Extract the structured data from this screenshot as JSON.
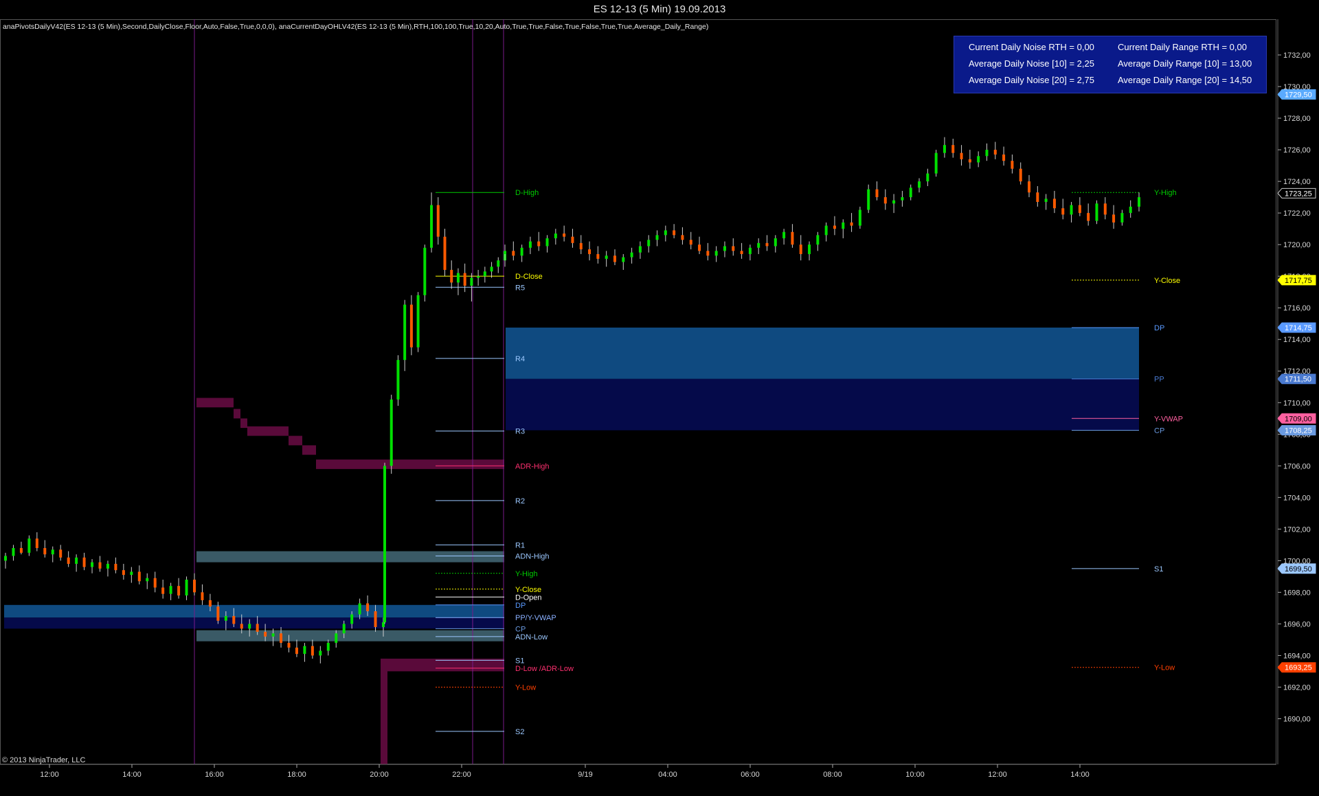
{
  "window": {
    "title": "ES 12-13 (5 Min)  19.09.2013"
  },
  "indicators_text": "anaPivotsDailyV42(ES 12-13 (5 Min),Second,DailyClose,Floor,Auto,False,True,0,0,0), anaCurrentDayOHLV42(ES 12-13 (5 Min),RTH,100,100,True,10,20,Auto,True,True,False,True,False,True,True,Average_Daily_Range)",
  "copyright": "© 2013 NinjaTrader, LLC",
  "infobox": {
    "current_noise": "Current Daily Noise RTH = 0,00",
    "current_range": "Current Daily Range RTH = 0,00",
    "avg_noise_10": "Average Daily Noise [10] = 2,25",
    "avg_range_10": "Average Daily Range [10] = 13,00",
    "avg_noise_20": "Average Daily Noise [20] = 2,75",
    "avg_range_20": "Average Daily Range [20] = 14,50"
  },
  "colors": {
    "background": "#000000",
    "up_candle": "#00e000",
    "down_candle": "#ff5a00",
    "pivot_line": "#9cc8ff",
    "high_line": "#00cc00",
    "close_line": "#ffff00",
    "low_line": "#ff4000",
    "adr_band": "#5a0a3a",
    "pivot_zone_upper": "#0f4a80",
    "pivot_zone_lower": "#050a4a",
    "adn_band": "#3a5a66",
    "session_divider": "#7a1a8a"
  },
  "chart_data": {
    "type": "candlestick",
    "title": "ES 12-13 (5 Min)  19.09.2013",
    "ylim": [
      1688.5,
      1733.0
    ],
    "y_ticks": [
      "1690,00",
      "1692,00",
      "1694,00",
      "1696,00",
      "1698,00",
      "1700,00",
      "1702,00",
      "1704,00",
      "1706,00",
      "1708,00",
      "1710,00",
      "1712,00",
      "1714,00",
      "1716,00",
      "1718,00",
      "1720,00",
      "1722,00",
      "1724,00",
      "1726,00",
      "1728,00",
      "1730,00",
      "1732,00"
    ],
    "x_ticks": [
      "12:00",
      "14:00",
      "16:00",
      "18:00",
      "20:00",
      "22:00",
      "9/19",
      "04:00",
      "06:00",
      "08:00",
      "10:00",
      "12:00",
      "14:00"
    ],
    "price_badges": [
      {
        "value": "1729,50",
        "color": "#5aaaff"
      },
      {
        "value": "1723,25",
        "color": "#000000"
      },
      {
        "value": "1717,75",
        "color": "#ffff00"
      },
      {
        "value": "1714,75",
        "color": "#5a9aff"
      },
      {
        "value": "1711,50",
        "color": "#4a7ad0"
      },
      {
        "value": "1709,00",
        "color": "#ff60a0"
      },
      {
        "value": "1708,25",
        "color": "#6a9ae0"
      },
      {
        "value": "1699,50",
        "color": "#9cc8ff"
      },
      {
        "value": "1693,25",
        "color": "#ff4000"
      }
    ],
    "prior_levels": [
      {
        "label": "D-High",
        "value": 1723.3,
        "color": "#00cc00",
        "style": "solid"
      },
      {
        "label": "D-Close",
        "value": 1718.0,
        "color": "#ffff00",
        "style": "solid"
      },
      {
        "label": "R5",
        "value": 1717.3,
        "color": "#9cc8ff",
        "style": "solid"
      },
      {
        "label": "R4",
        "value": 1712.8,
        "color": "#9cc8ff",
        "style": "solid"
      },
      {
        "label": "R3",
        "value": 1708.2,
        "color": "#9cc8ff",
        "style": "solid"
      },
      {
        "label": "ADR-High",
        "value": 1706.0,
        "color": "#ff3070",
        "style": "solid"
      },
      {
        "label": "R2",
        "value": 1703.8,
        "color": "#9cc8ff",
        "style": "solid"
      },
      {
        "label": "R1",
        "value": 1701.0,
        "color": "#9cc8ff",
        "style": "solid"
      },
      {
        "label": "ADN-High",
        "value": 1700.3,
        "color": "#9cc8ff",
        "style": "solid"
      },
      {
        "label": "Y-High",
        "value": 1699.2,
        "color": "#00cc00",
        "style": "dotted"
      },
      {
        "label": "Y-Close",
        "value": 1698.2,
        "color": "#ffff00",
        "style": "dotted"
      },
      {
        "label": "D-Open",
        "value": 1697.7,
        "color": "#ffffff",
        "style": "solid"
      },
      {
        "label": "DP",
        "value": 1697.2,
        "color": "#5a9aff",
        "style": "solid"
      },
      {
        "label": "PP/Y-VWAP",
        "value": 1696.4,
        "color": "#8ab0ff",
        "style": "solid"
      },
      {
        "label": "CP",
        "value": 1695.7,
        "color": "#6a9ae0",
        "style": "solid"
      },
      {
        "label": "ADN-Low",
        "value": 1695.2,
        "color": "#9cc8ff",
        "style": "solid"
      },
      {
        "label": "S1",
        "value": 1693.7,
        "color": "#9cc8ff",
        "style": "solid"
      },
      {
        "label": "D-Low /ADR-Low",
        "value": 1693.2,
        "color": "#ff3070",
        "style": "solid"
      },
      {
        "label": "Y-Low",
        "value": 1692.0,
        "color": "#ff4000",
        "style": "dotted"
      },
      {
        "label": "S2",
        "value": 1689.2,
        "color": "#9cc8ff",
        "style": "solid"
      }
    ],
    "current_levels": [
      {
        "label": "Y-High",
        "value": 1723.3,
        "color": "#00cc00",
        "style": "dotted"
      },
      {
        "label": "Y-Close",
        "value": 1717.75,
        "color": "#ffff00",
        "style": "dotted"
      },
      {
        "label": "DP",
        "value": 1714.75,
        "color": "#5a9aff",
        "style": "solid"
      },
      {
        "label": "PP",
        "value": 1711.5,
        "color": "#4a7ad0",
        "style": "solid"
      },
      {
        "label": "Y-VWAP",
        "value": 1709.0,
        "color": "#ff60a0",
        "style": "solid"
      },
      {
        "label": "CP",
        "value": 1708.25,
        "color": "#6a9ae0",
        "style": "solid"
      },
      {
        "label": "S1",
        "value": 1699.5,
        "color": "#9cc8ff",
        "style": "solid"
      },
      {
        "label": "Y-Low",
        "value": 1693.25,
        "color": "#ff4000",
        "style": "dotted"
      }
    ],
    "candles": [
      [
        1700.0,
        1700.5,
        1699.5,
        1700.3
      ],
      [
        1700.3,
        1701.0,
        1700.0,
        1700.8
      ],
      [
        1700.8,
        1701.2,
        1700.4,
        1700.5
      ],
      [
        1700.5,
        1701.6,
        1700.3,
        1701.4
      ],
      [
        1701.4,
        1701.8,
        1700.6,
        1700.8
      ],
      [
        1700.8,
        1701.3,
        1700.2,
        1700.4
      ],
      [
        1700.4,
        1700.9,
        1699.9,
        1700.7
      ],
      [
        1700.7,
        1701.0,
        1700.0,
        1700.2
      ],
      [
        1700.2,
        1700.6,
        1699.6,
        1699.8
      ],
      [
        1699.8,
        1700.4,
        1699.3,
        1700.2
      ],
      [
        1700.2,
        1700.5,
        1699.4,
        1699.6
      ],
      [
        1699.6,
        1700.1,
        1699.2,
        1699.9
      ],
      [
        1699.9,
        1700.3,
        1699.3,
        1699.5
      ],
      [
        1699.5,
        1700.0,
        1699.0,
        1699.8
      ],
      [
        1699.8,
        1700.2,
        1699.2,
        1699.4
      ],
      [
        1699.4,
        1699.8,
        1698.8,
        1699.1
      ],
      [
        1699.1,
        1699.6,
        1698.6,
        1699.3
      ],
      [
        1699.3,
        1699.7,
        1698.5,
        1698.7
      ],
      [
        1698.7,
        1699.2,
        1698.2,
        1698.9
      ],
      [
        1698.9,
        1699.3,
        1698.0,
        1698.3
      ],
      [
        1698.3,
        1698.8,
        1697.6,
        1697.9
      ],
      [
        1697.9,
        1698.6,
        1697.5,
        1698.4
      ],
      [
        1698.4,
        1698.9,
        1697.6,
        1697.8
      ],
      [
        1697.8,
        1699.0,
        1697.5,
        1698.8
      ],
      [
        1698.8,
        1699.2,
        1697.8,
        1698.0
      ],
      [
        1698.0,
        1698.5,
        1697.2,
        1697.5
      ],
      [
        1697.5,
        1697.9,
        1696.8,
        1697.1
      ],
      [
        1697.1,
        1697.4,
        1696.0,
        1696.2
      ],
      [
        1696.2,
        1696.8,
        1695.6,
        1696.5
      ],
      [
        1696.5,
        1697.0,
        1695.8,
        1696.0
      ],
      [
        1696.0,
        1696.6,
        1695.4,
        1695.7
      ],
      [
        1695.7,
        1696.3,
        1695.2,
        1696.0
      ],
      [
        1696.0,
        1696.5,
        1695.3,
        1695.5
      ],
      [
        1695.5,
        1696.0,
        1694.9,
        1695.2
      ],
      [
        1695.2,
        1695.7,
        1694.6,
        1695.4
      ],
      [
        1695.4,
        1695.8,
        1694.5,
        1694.8
      ],
      [
        1694.8,
        1695.3,
        1694.2,
        1694.5
      ],
      [
        1694.5,
        1695.0,
        1693.9,
        1694.1
      ],
      [
        1694.1,
        1694.8,
        1693.6,
        1694.6
      ],
      [
        1694.6,
        1695.0,
        1693.8,
        1694.0
      ],
      [
        1694.0,
        1694.6,
        1693.5,
        1694.3
      ],
      [
        1694.3,
        1695.0,
        1694.0,
        1694.8
      ],
      [
        1694.8,
        1695.6,
        1694.5,
        1695.4
      ],
      [
        1695.4,
        1696.2,
        1695.1,
        1696.0
      ],
      [
        1696.0,
        1696.8,
        1695.7,
        1696.6
      ],
      [
        1696.6,
        1697.6,
        1696.3,
        1697.3
      ],
      [
        1697.3,
        1697.8,
        1696.5,
        1696.8
      ],
      [
        1696.8,
        1697.2,
        1695.5,
        1695.8
      ],
      [
        1695.8,
        1696.4,
        1695.2,
        1696.1
      ],
      [
        1696.1,
        1706.2,
        1696.0,
        1706.0
      ],
      [
        1706.0,
        1710.5,
        1705.5,
        1710.2
      ],
      [
        1710.2,
        1713.0,
        1709.8,
        1712.7
      ],
      [
        1712.7,
        1716.5,
        1712.0,
        1716.2
      ],
      [
        1716.2,
        1716.8,
        1713.0,
        1713.5
      ],
      [
        1713.5,
        1717.0,
        1713.2,
        1716.8
      ],
      [
        1716.8,
        1720.0,
        1716.4,
        1719.8
      ],
      [
        1719.8,
        1723.3,
        1719.5,
        1722.5
      ],
      [
        1722.5,
        1723.0,
        1720.0,
        1720.5
      ],
      [
        1720.5,
        1721.0,
        1718.0,
        1718.4
      ],
      [
        1718.4,
        1719.0,
        1717.2,
        1717.6
      ],
      [
        1717.6,
        1718.5,
        1716.8,
        1718.2
      ],
      [
        1718.2,
        1718.8,
        1717.0,
        1717.4
      ],
      [
        1717.4,
        1718.2,
        1716.4,
        1717.9
      ],
      [
        1717.9,
        1718.4,
        1717.4,
        1718.0
      ],
      [
        1718.0,
        1718.6,
        1717.6,
        1718.3
      ],
      [
        1718.3,
        1718.9,
        1717.9,
        1718.6
      ],
      [
        1718.6,
        1719.2,
        1718.2,
        1719.0
      ],
      [
        1719.0,
        1719.7,
        1718.6,
        1719.4
      ],
      [
        1719.4,
        1720.0,
        1719.0,
        1719.6
      ],
      [
        1719.6,
        1720.2,
        1719.0,
        1719.3
      ],
      [
        1719.3,
        1720.0,
        1718.9,
        1719.8
      ],
      [
        1719.8,
        1720.5,
        1719.4,
        1720.2
      ],
      [
        1720.2,
        1720.8,
        1719.6,
        1719.9
      ],
      [
        1719.9,
        1720.6,
        1719.5,
        1720.4
      ],
      [
        1720.4,
        1721.0,
        1720.0,
        1720.7
      ],
      [
        1720.7,
        1721.2,
        1720.2,
        1720.5
      ],
      [
        1720.5,
        1721.0,
        1719.8,
        1720.1
      ],
      [
        1720.1,
        1720.6,
        1719.4,
        1719.7
      ],
      [
        1719.7,
        1720.2,
        1719.0,
        1719.4
      ],
      [
        1719.4,
        1719.9,
        1718.8,
        1719.1
      ],
      [
        1719.1,
        1719.6,
        1718.6,
        1719.3
      ],
      [
        1719.3,
        1719.7,
        1718.7,
        1718.9
      ],
      [
        1718.9,
        1719.4,
        1718.4,
        1719.2
      ],
      [
        1719.2,
        1719.8,
        1718.8,
        1719.5
      ],
      [
        1719.5,
        1720.2,
        1719.1,
        1719.9
      ],
      [
        1719.9,
        1720.6,
        1719.5,
        1720.3
      ],
      [
        1720.3,
        1720.9,
        1719.9,
        1720.6
      ],
      [
        1720.6,
        1721.2,
        1720.2,
        1720.9
      ],
      [
        1720.9,
        1721.3,
        1720.4,
        1720.6
      ],
      [
        1720.6,
        1721.1,
        1720.0,
        1720.3
      ],
      [
        1720.3,
        1720.8,
        1719.7,
        1720.0
      ],
      [
        1720.0,
        1720.5,
        1719.4,
        1719.6
      ],
      [
        1719.6,
        1720.1,
        1719.0,
        1719.3
      ],
      [
        1719.3,
        1719.9,
        1718.9,
        1719.6
      ],
      [
        1719.6,
        1720.2,
        1719.2,
        1719.9
      ],
      [
        1719.9,
        1720.4,
        1719.3,
        1719.6
      ],
      [
        1719.6,
        1720.1,
        1719.1,
        1719.4
      ],
      [
        1719.4,
        1720.0,
        1719.0,
        1719.8
      ],
      [
        1719.8,
        1720.4,
        1719.4,
        1720.1
      ],
      [
        1720.1,
        1720.6,
        1719.6,
        1719.9
      ],
      [
        1719.9,
        1720.6,
        1719.5,
        1720.4
      ],
      [
        1720.4,
        1721.0,
        1720.0,
        1720.8
      ],
      [
        1720.8,
        1721.3,
        1719.8,
        1720.0
      ],
      [
        1720.0,
        1720.6,
        1719.0,
        1719.4
      ],
      [
        1719.4,
        1720.2,
        1719.0,
        1720.0
      ],
      [
        1720.0,
        1720.8,
        1719.6,
        1720.6
      ],
      [
        1720.6,
        1721.4,
        1720.2,
        1721.2
      ],
      [
        1721.2,
        1721.8,
        1720.6,
        1721.0
      ],
      [
        1721.0,
        1721.6,
        1720.4,
        1721.4
      ],
      [
        1721.4,
        1722.0,
        1720.8,
        1721.2
      ],
      [
        1721.2,
        1722.4,
        1721.0,
        1722.2
      ],
      [
        1722.2,
        1723.8,
        1722.0,
        1723.5
      ],
      [
        1723.5,
        1724.0,
        1722.8,
        1723.0
      ],
      [
        1723.0,
        1723.5,
        1722.2,
        1722.6
      ],
      [
        1722.6,
        1723.2,
        1722.0,
        1722.8
      ],
      [
        1722.8,
        1723.4,
        1722.4,
        1723.0
      ],
      [
        1723.0,
        1723.8,
        1722.8,
        1723.6
      ],
      [
        1723.6,
        1724.2,
        1723.3,
        1724.0
      ],
      [
        1724.0,
        1724.8,
        1723.7,
        1724.5
      ],
      [
        1724.5,
        1726.0,
        1724.3,
        1725.8
      ],
      [
        1725.8,
        1726.8,
        1725.5,
        1726.3
      ],
      [
        1726.3,
        1726.7,
        1725.5,
        1725.8
      ],
      [
        1725.8,
        1726.3,
        1725.0,
        1725.4
      ],
      [
        1725.4,
        1726.0,
        1724.8,
        1725.2
      ],
      [
        1725.2,
        1725.9,
        1724.9,
        1725.6
      ],
      [
        1725.6,
        1726.4,
        1725.3,
        1726.0
      ],
      [
        1726.0,
        1726.5,
        1725.4,
        1725.7
      ],
      [
        1725.7,
        1726.2,
        1725.0,
        1725.3
      ],
      [
        1725.3,
        1725.7,
        1724.5,
        1724.8
      ],
      [
        1724.8,
        1725.2,
        1723.8,
        1724.0
      ],
      [
        1724.0,
        1724.4,
        1723.0,
        1723.3
      ],
      [
        1723.3,
        1723.7,
        1722.4,
        1722.7
      ],
      [
        1722.7,
        1723.2,
        1722.2,
        1722.9
      ],
      [
        1722.9,
        1723.4,
        1722.0,
        1722.3
      ],
      [
        1722.3,
        1722.9,
        1721.6,
        1721.9
      ],
      [
        1721.9,
        1722.7,
        1721.4,
        1722.5
      ],
      [
        1722.5,
        1723.0,
        1721.8,
        1722.0
      ],
      [
        1722.0,
        1722.6,
        1721.2,
        1721.5
      ],
      [
        1721.5,
        1722.8,
        1721.3,
        1722.6
      ],
      [
        1722.6,
        1723.0,
        1721.6,
        1721.9
      ],
      [
        1721.9,
        1722.5,
        1721.0,
        1721.4
      ],
      [
        1721.4,
        1722.2,
        1721.2,
        1722.0
      ],
      [
        1722.0,
        1722.8,
        1721.7,
        1722.4
      ],
      [
        1722.4,
        1723.3,
        1722.1,
        1723.0
      ]
    ]
  }
}
